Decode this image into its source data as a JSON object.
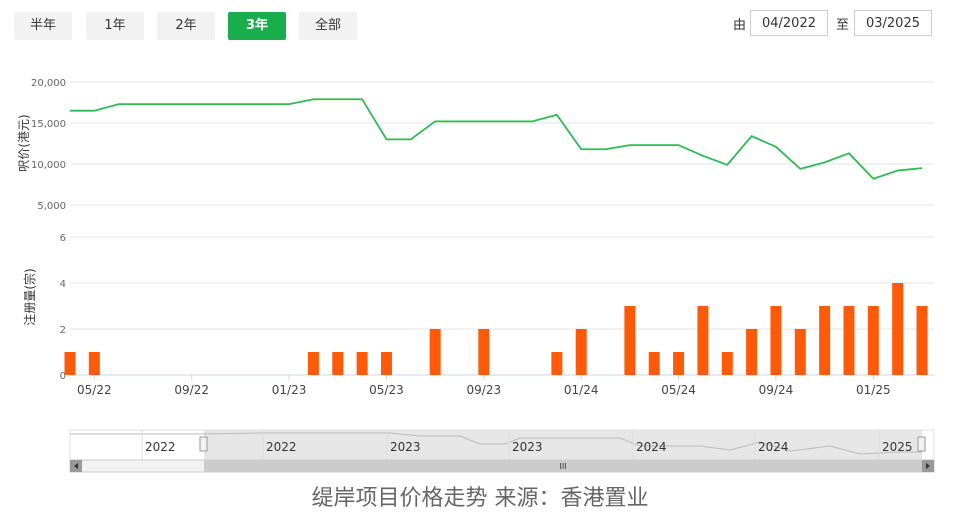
{
  "range_buttons": [
    "半年",
    "1年",
    "2年",
    "3年",
    "全部"
  ],
  "active_range": "3年",
  "date_range": {
    "from_label": "由",
    "from": "04/2022",
    "to_label": "至",
    "to": "03/2025"
  },
  "caption": "缇岸项目价格走势 来源：香港置业",
  "colors": {
    "price_line": "#2dbb55",
    "volume_bar": "#ff5a0a",
    "active_button": "#1aad4b"
  },
  "chart_data": [
    {
      "type": "line",
      "ylabel": "呎价(港元)",
      "ylim": [
        5000,
        20000
      ],
      "yticks": [
        "5,000",
        "10,000",
        "15,000",
        "20,000"
      ],
      "grid": true,
      "x": [
        "04/22",
        "05/22",
        "06/22",
        "07/22",
        "08/22",
        "09/22",
        "10/22",
        "11/22",
        "12/22",
        "01/23",
        "02/23",
        "03/23",
        "04/23",
        "05/23",
        "06/23",
        "07/23",
        "08/23",
        "09/23",
        "10/23",
        "11/23",
        "12/23",
        "01/24",
        "02/24",
        "03/24",
        "04/24",
        "05/24",
        "06/24",
        "07/24",
        "08/24",
        "09/24",
        "10/24",
        "11/24",
        "12/24",
        "01/25",
        "02/25",
        "03/25"
      ],
      "series": [
        {
          "values": [
            16500,
            16500,
            17300,
            17300,
            17300,
            17300,
            17300,
            17300,
            17300,
            17300,
            17900,
            17900,
            17900,
            13000,
            13000,
            15200,
            15200,
            15200,
            15200,
            15200,
            16000,
            11800,
            11800,
            12300,
            12300,
            12300,
            11000,
            9900,
            13400,
            12100,
            9400,
            10200,
            11300,
            8200,
            9200,
            9500
          ]
        }
      ]
    },
    {
      "type": "bar",
      "ylabel": "注册量(宗)",
      "ylim": [
        0,
        6
      ],
      "yticks": [
        "0",
        "2",
        "4",
        "6"
      ],
      "grid": true,
      "x": [
        "04/22",
        "05/22",
        "06/22",
        "07/22",
        "08/22",
        "09/22",
        "10/22",
        "11/22",
        "12/22",
        "01/23",
        "02/23",
        "03/23",
        "04/23",
        "05/23",
        "06/23",
        "07/23",
        "08/23",
        "09/23",
        "10/23",
        "11/23",
        "12/23",
        "01/24",
        "02/24",
        "03/24",
        "04/24",
        "05/24",
        "06/24",
        "07/24",
        "08/24",
        "09/24",
        "10/24",
        "11/24",
        "12/24",
        "01/25",
        "02/25",
        "03/25"
      ],
      "xticks": [
        "05/22",
        "09/22",
        "01/23",
        "05/23",
        "09/23",
        "01/24",
        "05/24",
        "09/24",
        "01/25"
      ],
      "series": [
        {
          "values": [
            1,
            1,
            0,
            0,
            0,
            0,
            0,
            0,
            0,
            0,
            1,
            1,
            1,
            1,
            0,
            2,
            0,
            2,
            0,
            0,
            1,
            2,
            0,
            3,
            1,
            1,
            3,
            1,
            2,
            3,
            2,
            3,
            3,
            3,
            4,
            3
          ]
        }
      ]
    }
  ],
  "navigator": {
    "labels": [
      "2022",
      "2022",
      "2023",
      "2023",
      "2024",
      "2024",
      "2025"
    ],
    "scroll_handle": "III"
  }
}
